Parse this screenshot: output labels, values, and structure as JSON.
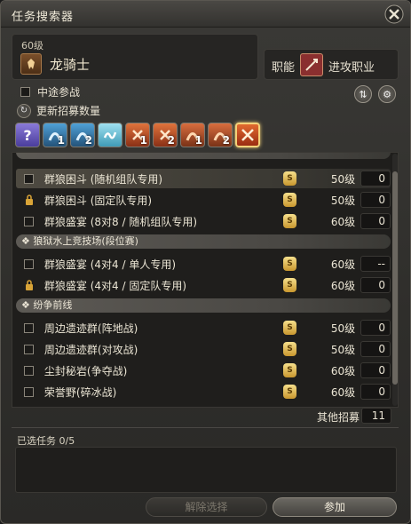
{
  "window": {
    "title": "任务搜索器"
  },
  "job": {
    "level": "60级",
    "name": "龙骑士"
  },
  "role": {
    "label": "职能",
    "value": "进攻职业"
  },
  "options": {
    "join_in_progress": "中途参战",
    "update_recruit": "更新招募数量"
  },
  "filters": [
    {
      "icon": "question-icon",
      "badge": ""
    },
    {
      "icon": "dungeon-1-icon",
      "badge": "1"
    },
    {
      "icon": "dungeon-2-icon",
      "badge": "2"
    },
    {
      "icon": "wave-icon",
      "badge": ""
    },
    {
      "icon": "trial-1-icon",
      "badge": "1"
    },
    {
      "icon": "trial-2-icon",
      "badge": "2"
    },
    {
      "icon": "raid-1-icon",
      "badge": "1"
    },
    {
      "icon": "raid-2-icon",
      "badge": "2"
    },
    {
      "icon": "pvp-icon",
      "badge": ""
    }
  ],
  "categories": [
    {
      "label": "狼狱水上竞技场(段位赛)"
    },
    {
      "label": "纷争前线"
    }
  ],
  "rows": [
    {
      "name": "群狼困斗 (随机组队专用)",
      "level": "50级",
      "count": "0",
      "locked": false
    },
    {
      "name": "群狼困斗 (固定队专用)",
      "level": "50级",
      "count": "0",
      "locked": true
    },
    {
      "name": "群狼盛宴 (8对8 / 随机组队专用)",
      "level": "60级",
      "count": "0",
      "locked": false
    },
    {
      "name": "群狼盛宴 (4对4 / 单人专用)",
      "level": "60级",
      "count": "--",
      "locked": false
    },
    {
      "name": "群狼盛宴 (4对4 / 固定队专用)",
      "level": "60级",
      "count": "0",
      "locked": true
    },
    {
      "name": "周边遗迹群(阵地战)",
      "level": "50级",
      "count": "0",
      "locked": false
    },
    {
      "name": "周边遗迹群(对攻战)",
      "level": "50级",
      "count": "0",
      "locked": false
    },
    {
      "name": "尘封秘岩(争夺战)",
      "level": "60级",
      "count": "0",
      "locked": false
    },
    {
      "name": "荣誉野(碎冰战)",
      "level": "60级",
      "count": "0",
      "locked": false
    }
  ],
  "footer": {
    "other_label": "其他招募",
    "other_value": "11",
    "selected": "已选任务 0/5",
    "clear_button": "解除选择",
    "join_button": "参加"
  }
}
